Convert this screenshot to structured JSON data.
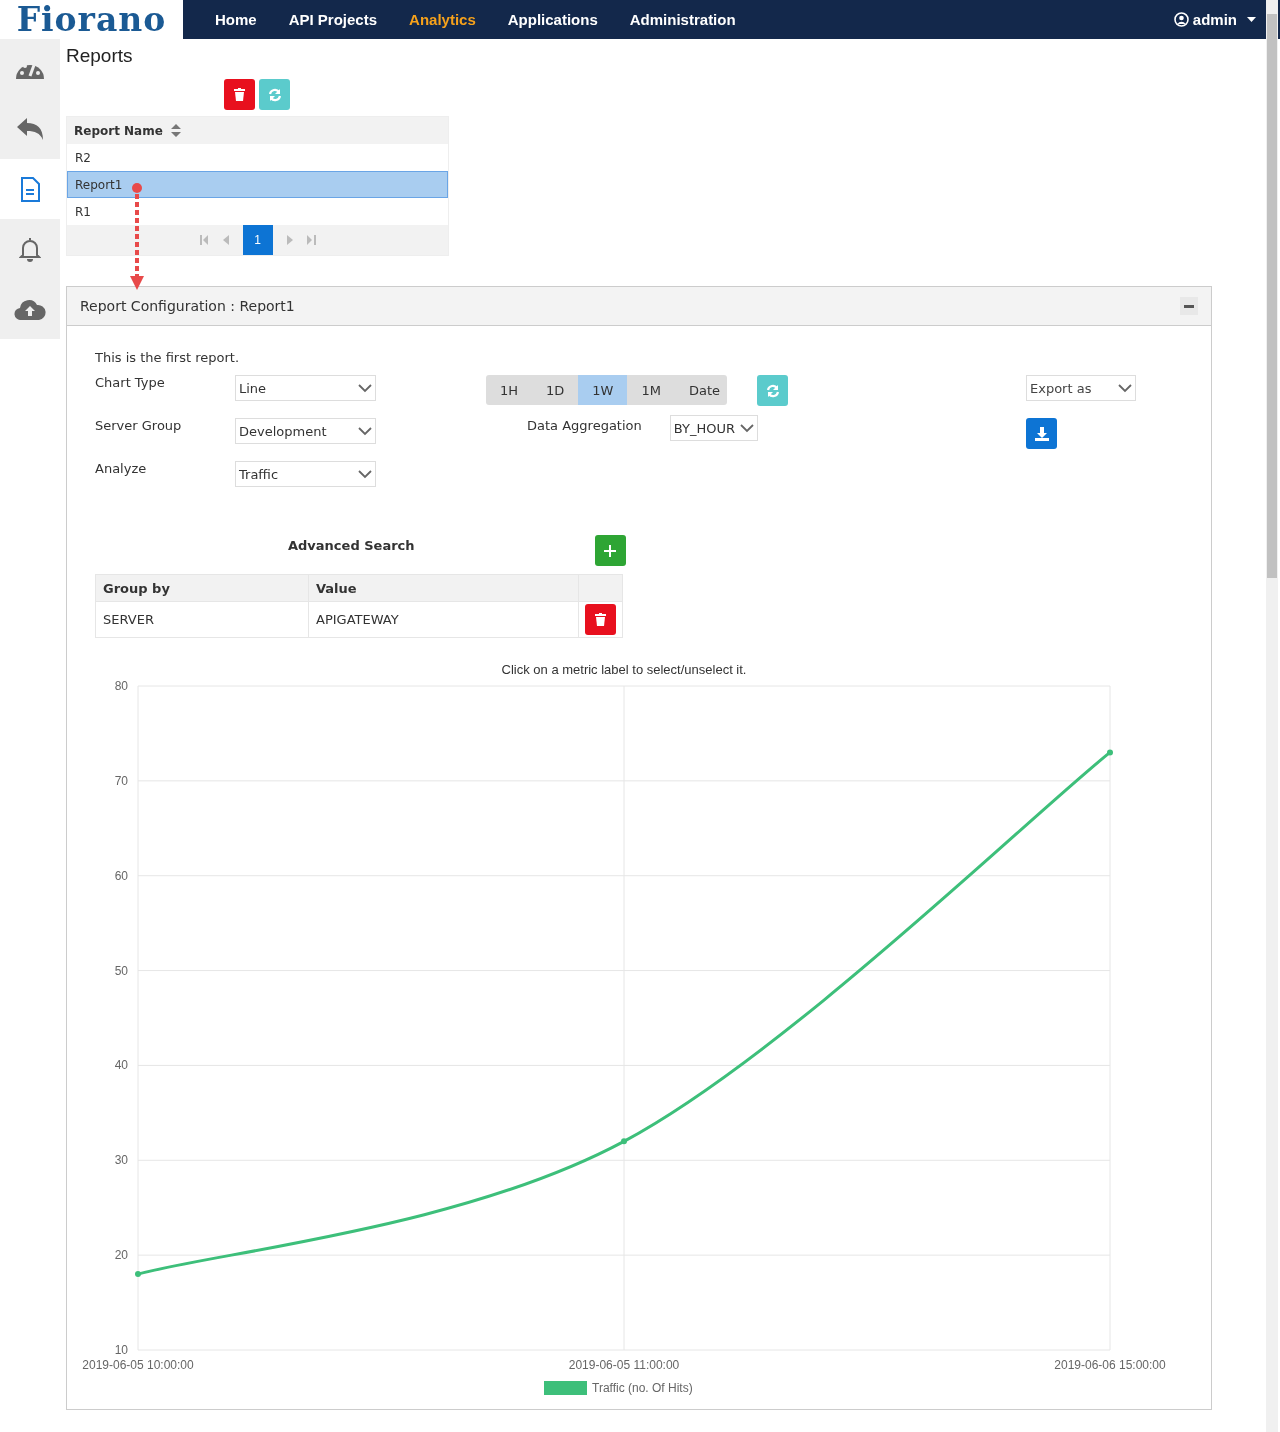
{
  "logo": "Fiorano",
  "nav": [
    {
      "label": "Home",
      "selected": false
    },
    {
      "label": "API Projects",
      "selected": false
    },
    {
      "label": "Analytics",
      "selected": true
    },
    {
      "label": "Applications",
      "selected": false
    },
    {
      "label": "Administration",
      "selected": false
    }
  ],
  "user": "admin",
  "sidebar": {
    "items": [
      {
        "kind": "gauge",
        "selected": false
      },
      {
        "kind": "undo",
        "selected": false
      },
      {
        "kind": "document",
        "selected": true
      },
      {
        "kind": "bell",
        "selected": false
      },
      {
        "kind": "upload",
        "selected": false
      }
    ]
  },
  "page_title": "Reports",
  "reports_table": {
    "column": "Report Name",
    "rows": [
      {
        "name": "R2",
        "selected": false
      },
      {
        "name": "Report1",
        "selected": true
      },
      {
        "name": "R1",
        "selected": false
      }
    ],
    "pages": [
      {
        "label": "1",
        "selected": true
      }
    ]
  },
  "panel": {
    "title": "Report Configuration : Report1",
    "description": "This is the first report.",
    "fields": [
      {
        "label": "Chart Type",
        "value": "Line"
      },
      {
        "label": "Server Group",
        "value": "Development"
      },
      {
        "label": "Analyze",
        "value": "Traffic"
      }
    ],
    "ranges": [
      {
        "label": "1H",
        "selected": false
      },
      {
        "label": "1D",
        "selected": false
      },
      {
        "label": "1W",
        "selected": true
      },
      {
        "label": "1M",
        "selected": false
      },
      {
        "label": "Date",
        "selected": false
      }
    ],
    "aggregation": {
      "label": "Data Aggregation",
      "value": "BY_HOUR"
    },
    "export": {
      "placeholder": "Export as"
    },
    "advanced_search": {
      "title": "Advanced Search",
      "columns": [
        "Group by",
        "Value"
      ],
      "rows": [
        {
          "group_by": "SERVER",
          "value": "APIGATEWAY"
        }
      ]
    },
    "chart_hint": "Click on a metric label to select/unselect it.",
    "chart_data": {
      "type": "line",
      "categories": [
        "2019-06-05 10:00:00",
        "2019-06-05 11:00:00",
        "2019-06-06 15:00:00"
      ],
      "series": [
        {
          "name": "Traffic (no. Of Hits)",
          "color": "#3dbf7a",
          "marker": true,
          "values": [
            18,
            32,
            73
          ]
        }
      ],
      "grid": true,
      "ylim": [
        10,
        80
      ],
      "yticks": [
        10,
        20,
        30,
        40,
        50,
        60,
        70,
        80
      ]
    }
  }
}
